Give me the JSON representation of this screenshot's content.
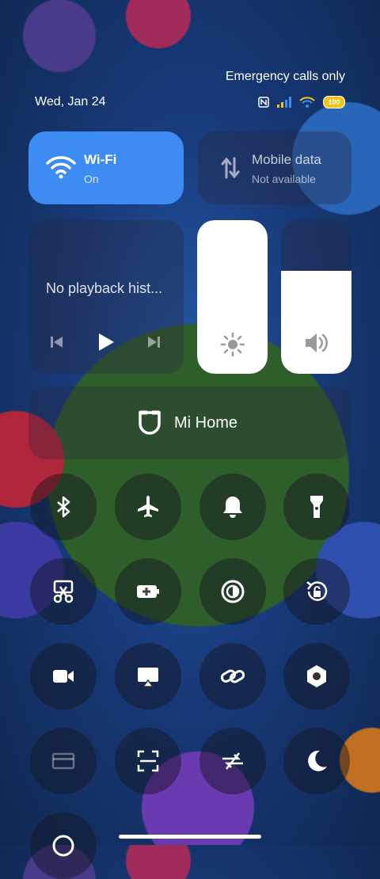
{
  "status": {
    "date": "Wed, Jan 24",
    "emergency": "Emergency calls only",
    "battery": "100"
  },
  "wifi": {
    "title": "Wi-Fi",
    "state": "On",
    "icon": "wifi-icon"
  },
  "mobile": {
    "title": "Mobile data",
    "state": "Not available",
    "icon": "mobile-data-icon"
  },
  "media": {
    "placeholder": "No playback hist...",
    "controls": [
      "previous-icon",
      "play-icon",
      "next-icon"
    ]
  },
  "brightness": {
    "level": 1.0,
    "icon": "sun-icon"
  },
  "volume": {
    "level": 0.67,
    "icon": "speaker-icon"
  },
  "mihome": {
    "label": "Mi Home",
    "icon": "mi-home-icon"
  },
  "toggles": [
    "bluetooth-icon",
    "airplane-icon",
    "bell-icon",
    "flashlight-icon",
    "scissors-icon",
    "battery-saver-icon",
    "dark-mode-icon",
    "rotation-lock-icon",
    "video-icon",
    "cast-icon",
    "link-icon",
    "hexagon-settings-icon",
    "card-icon",
    "scan-icon",
    "sync-icon",
    "moon-icon"
  ],
  "colors": {
    "wifi_active": "#3d8cf4",
    "slider_fill": "#ffffff",
    "battery": "#f2c318"
  }
}
